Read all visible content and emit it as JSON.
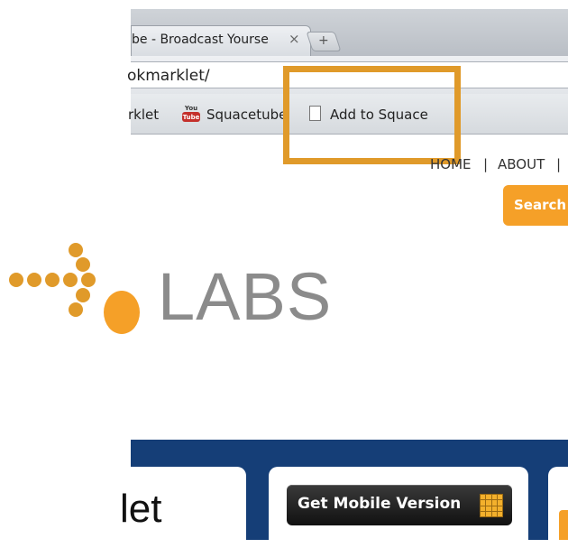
{
  "browser": {
    "tab_title": "be - Broadcast Yourse",
    "tab_close": "×",
    "new_tab": "+",
    "url": "okmarklet/",
    "bookmarks": {
      "item1": "rklet",
      "item2": "Squacetube",
      "item3": "Add to Squace"
    },
    "youtube_icon_top": "You",
    "youtube_icon_bottom": "Tube"
  },
  "page": {
    "nav": {
      "home": "HOME",
      "sep": "|",
      "about": "ABOUT",
      "sep2": "|"
    },
    "search_button": "Search",
    "logo_text": "LABS",
    "card_left_text": "let",
    "mobile_button": "Get Mobile Version"
  },
  "colors": {
    "accent_orange": "#f5a028",
    "highlight": "#e09a2a",
    "band_blue": "#153e77"
  }
}
